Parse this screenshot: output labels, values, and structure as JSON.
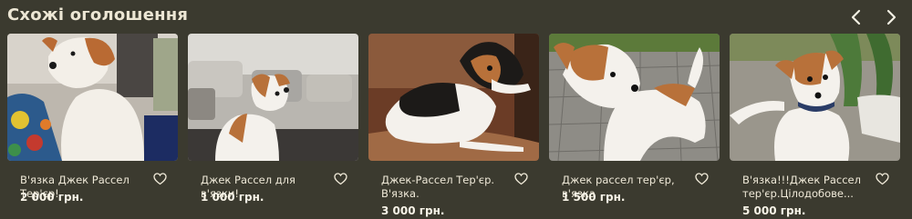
{
  "section": {
    "title": "Схожі оголошення"
  },
  "cards": [
    {
      "title": "В'язка Джек Рассел Тер'єр!",
      "price": "2 000 грн."
    },
    {
      "title": "Джек Рассел для в'язки!",
      "price": "1 000 грн."
    },
    {
      "title": "Джек-Рассел Тер'єр. В'язка.",
      "price": "3 000 грн."
    },
    {
      "title": "Джек рассел тер'єр, в'язка",
      "price": "1 500 грн."
    },
    {
      "title": "В'язка!!!Джек Рассел тер'єр.Цілодобове...",
      "price": "5 000 грн."
    }
  ],
  "icons": {
    "prev": "chevron-left-icon",
    "next": "chevron-right-icon",
    "favorite": "heart-outline-icon"
  },
  "colors": {
    "background": "#3b3a2f",
    "text": "#efe9d8"
  }
}
